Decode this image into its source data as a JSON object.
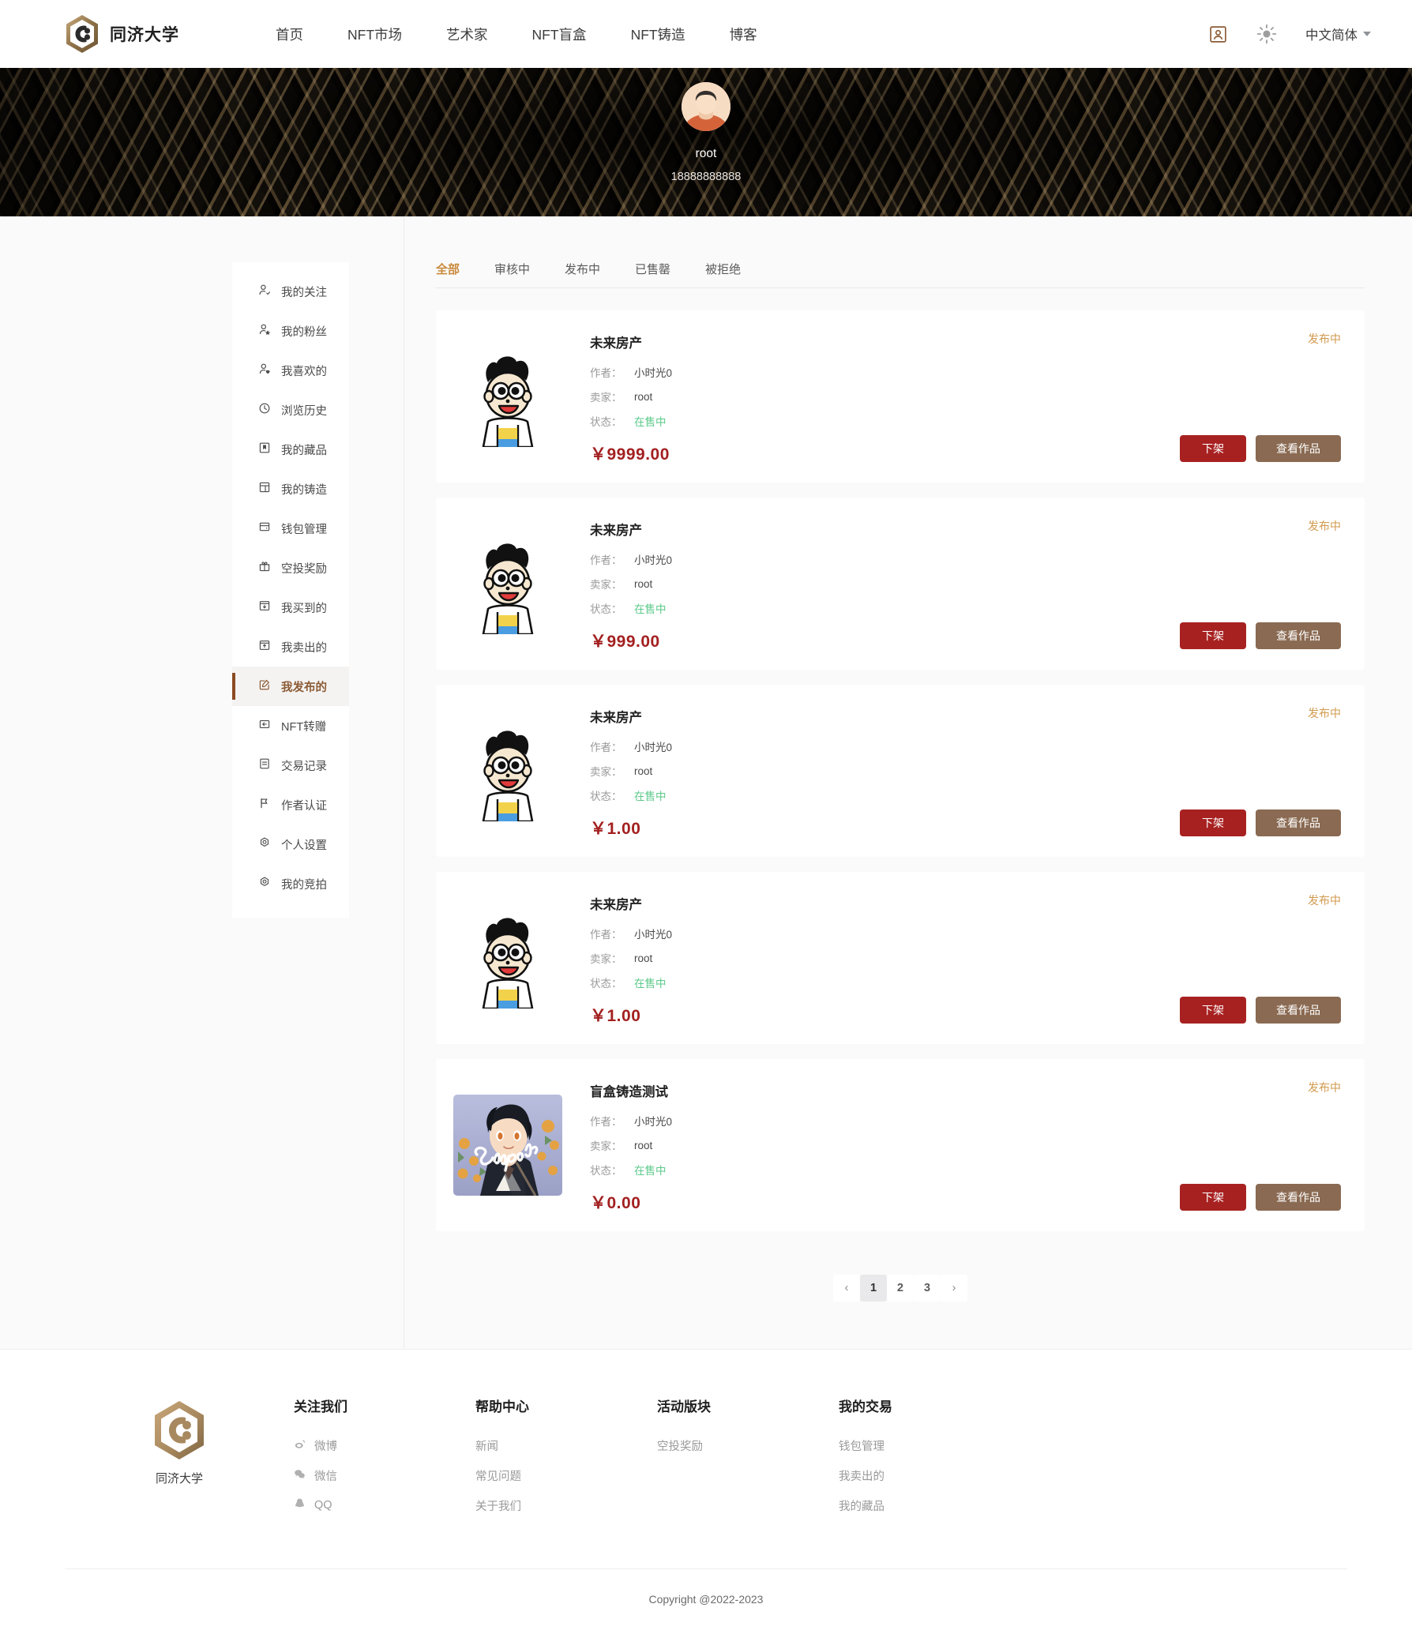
{
  "header": {
    "brand": "同济大学",
    "logo_icon": "hexagon-c-logo-icon",
    "nav": [
      {
        "label": "首页",
        "name": "nav-home"
      },
      {
        "label": "NFT市场",
        "name": "nav-market"
      },
      {
        "label": "艺术家",
        "name": "nav-artists"
      },
      {
        "label": "NFT盲盒",
        "name": "nav-blindbox"
      },
      {
        "label": "NFT铸造",
        "name": "nav-mint"
      },
      {
        "label": "博客",
        "name": "nav-blog"
      }
    ],
    "user_icon": "user-card-icon",
    "theme_icon": "sun-icon",
    "language": "中文简体"
  },
  "profile": {
    "avatar_icon": "avatar",
    "name": "root",
    "phone": "18888888888"
  },
  "sidebar": {
    "items": [
      {
        "label": "我的关注",
        "icon": "user-check-icon",
        "name": "sidebar-item-following",
        "active": false
      },
      {
        "label": "我的粉丝",
        "icon": "user-star-icon",
        "name": "sidebar-item-fans",
        "active": false
      },
      {
        "label": "我喜欢的",
        "icon": "user-heart-icon",
        "name": "sidebar-item-liked",
        "active": false
      },
      {
        "label": "浏览历史",
        "icon": "clock-icon",
        "name": "sidebar-item-history",
        "active": false
      },
      {
        "label": "我的藏品",
        "icon": "bookmark-icon",
        "name": "sidebar-item-collection",
        "active": false
      },
      {
        "label": "我的铸造",
        "icon": "layout-icon",
        "name": "sidebar-item-minting",
        "active": false
      },
      {
        "label": "钱包管理",
        "icon": "wallet-icon",
        "name": "sidebar-item-wallet",
        "active": false
      },
      {
        "label": "空投奖励",
        "icon": "gift-icon",
        "name": "sidebar-item-airdrop",
        "active": false
      },
      {
        "label": "我买到的",
        "icon": "box-download-icon",
        "name": "sidebar-item-purchased",
        "active": false
      },
      {
        "label": "我卖出的",
        "icon": "box-upload-icon",
        "name": "sidebar-item-sold",
        "active": false
      },
      {
        "label": "我发布的",
        "icon": "edit-square-icon",
        "name": "sidebar-item-published",
        "active": true
      },
      {
        "label": "NFT转赠",
        "icon": "transfer-icon",
        "name": "sidebar-item-transfer",
        "active": false
      },
      {
        "label": "交易记录",
        "icon": "list-icon",
        "name": "sidebar-item-transactions",
        "active": false
      },
      {
        "label": "作者认证",
        "icon": "flag-icon",
        "name": "sidebar-item-verification",
        "active": false
      },
      {
        "label": "个人设置",
        "icon": "gear-icon",
        "name": "sidebar-item-settings",
        "active": false
      },
      {
        "label": "我的竞拍",
        "icon": "gear-icon",
        "name": "sidebar-item-auction",
        "active": false
      }
    ]
  },
  "main": {
    "tabs": [
      {
        "label": "全部",
        "name": "tab-all",
        "active": true
      },
      {
        "label": "审核中",
        "name": "tab-reviewing",
        "active": false
      },
      {
        "label": "发布中",
        "name": "tab-publishing",
        "active": false
      },
      {
        "label": "已售罄",
        "name": "tab-soldout",
        "active": false
      },
      {
        "label": "被拒绝",
        "name": "tab-rejected",
        "active": false
      }
    ],
    "labels": {
      "author": "作者：",
      "seller": "卖家：",
      "state": "状态："
    },
    "buttons": {
      "delist": "下架",
      "view": "查看作品"
    },
    "cards": [
      {
        "title": "未来房产",
        "author": "小时光0",
        "seller": "root",
        "state": "在售中",
        "price": "￥9999.00",
        "status": "发布中",
        "thumb": "cartoon-boy-icon"
      },
      {
        "title": "未来房产",
        "author": "小时光0",
        "seller": "root",
        "state": "在售中",
        "price": "￥999.00",
        "status": "发布中",
        "thumb": "cartoon-boy-icon"
      },
      {
        "title": "未来房产",
        "author": "小时光0",
        "seller": "root",
        "state": "在售中",
        "price": "￥1.00",
        "status": "发布中",
        "thumb": "cartoon-boy-icon"
      },
      {
        "title": "未来房产",
        "author": "小时光0",
        "seller": "root",
        "state": "在售中",
        "price": "￥1.00",
        "status": "发布中",
        "thumb": "cartoon-boy-icon"
      },
      {
        "title": "盲盒铸造测试",
        "author": "小时光0",
        "seller": "root",
        "state": "在售中",
        "price": "￥0.00",
        "status": "发布中",
        "thumb": "anime-sample-artwork"
      }
    ],
    "pagination": {
      "prev": "‹",
      "next": "›",
      "pages": [
        "1",
        "2",
        "3"
      ],
      "current": "1"
    }
  },
  "footer": {
    "brand": "同济大学",
    "logo_icon": "hexagon-c-logo-icon",
    "columns": [
      {
        "heading": "关注我们",
        "name": "footer-col-follow",
        "links": [
          {
            "label": "微博",
            "icon": "weibo-icon"
          },
          {
            "label": "微信",
            "icon": "wechat-icon"
          },
          {
            "label": "QQ",
            "icon": "qq-icon"
          }
        ]
      },
      {
        "heading": "帮助中心",
        "name": "footer-col-help",
        "links": [
          {
            "label": "新闻",
            "icon": ""
          },
          {
            "label": "常见问题",
            "icon": ""
          },
          {
            "label": "关于我们",
            "icon": ""
          }
        ]
      },
      {
        "heading": "活动版块",
        "name": "footer-col-activity",
        "links": [
          {
            "label": "空投奖励",
            "icon": ""
          }
        ]
      },
      {
        "heading": "我的交易",
        "name": "footer-col-trade",
        "links": [
          {
            "label": "钱包管理",
            "icon": ""
          },
          {
            "label": "我卖出的",
            "icon": ""
          },
          {
            "label": "我的藏品",
            "icon": ""
          }
        ]
      }
    ],
    "copyright": "Copyright @2022-2023"
  },
  "colors": {
    "accent_gold": "#c98a3c",
    "brand_brown": "#8b5a34",
    "price_red": "#a32020",
    "btn_delist": "#a82121",
    "btn_view": "#8a6a52",
    "selling_green": "#5cc98a"
  }
}
